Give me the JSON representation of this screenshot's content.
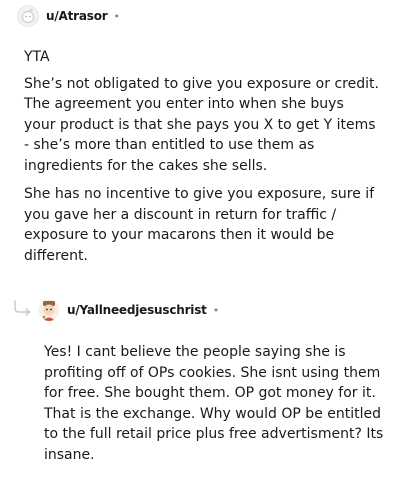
{
  "comments": [
    {
      "username": "u/Atrasor",
      "avatar_icon": "default-snoo-avatar-icon",
      "separator": "•",
      "paragraphs": [
        "YTA",
        "She’s not obligated to give you exposure or credit. The agreement you enter into when she buys your product is that she pays you X to get Y items - she’s more than entitled to use them as ingredients for the cakes she sells.",
        "She has no incentive to give you exposure, sure if you gave her a discount in return for traffic / exposure to your macarons then it would be different."
      ]
    },
    {
      "username": "u/Yallneedjesuschrist",
      "avatar_icon": "cartoon-avatar-icon",
      "separator": "•",
      "is_reply": true,
      "reply_icon": "reply-arrow-icon",
      "paragraphs": [
        "Yes! I cant believe the people saying she is profiting off of OPs cookies. She isnt using them for free. She bought them. OP got money for it. That is the exchange. Why would OP be entitled to the full retail price plus free advertisment? Its insane."
      ]
    }
  ],
  "colors": {
    "text": "#1a1a1b",
    "meta": "#878a8c",
    "reply_arrow": "#c8cbcd"
  }
}
